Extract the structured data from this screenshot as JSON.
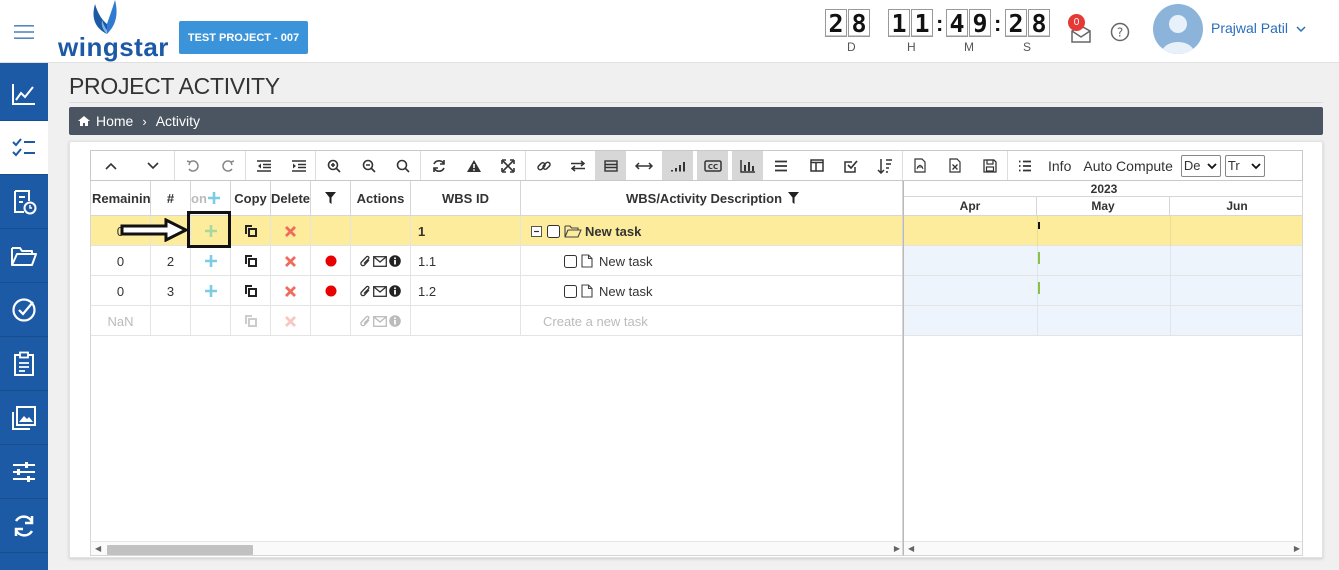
{
  "app": {
    "logo_text": "wingstar"
  },
  "header": {
    "project_button": "TEST PROJECT - 007",
    "timer": {
      "days": "28",
      "hours": "11",
      "minutes": "49",
      "seconds": "28",
      "labels": {
        "d": "D",
        "h": "H",
        "m": "M",
        "s": "S"
      }
    },
    "notification_count": "0",
    "user_name": "Prajwal Patil"
  },
  "sidebar": {
    "items": [
      {
        "icon": "chart-line-icon",
        "active": false
      },
      {
        "icon": "tasklist-icon",
        "active": true
      },
      {
        "icon": "document-clock-icon",
        "active": false
      },
      {
        "icon": "folder-open-icon",
        "active": false
      },
      {
        "icon": "check-circle-icon",
        "active": false
      },
      {
        "icon": "clipboard-icon",
        "active": false
      },
      {
        "icon": "gallery-icon",
        "active": false
      },
      {
        "icon": "sliders-icon",
        "active": false
      },
      {
        "icon": "sync-icon",
        "active": false
      }
    ]
  },
  "page": {
    "title": "PROJECT ACTIVITY",
    "breadcrumb": {
      "home": "Home",
      "current": "Activity"
    }
  },
  "toolbar": {
    "info_label": "Info",
    "auto_compute_label": "Auto Compute",
    "select1_value": "De",
    "select2_value": "Tr",
    "icons": [
      "chevron-up-icon",
      "chevron-down-icon",
      "undo-icon",
      "redo-icon",
      "outdent-icon",
      "indent-icon",
      "zoom-in-icon",
      "zoom-out-icon",
      "search-icon",
      "refresh-icon",
      "warning-icon",
      "expand-icon",
      "link-icon",
      "swap-icon",
      "rows-icon",
      "width-icon",
      "signal-icon",
      "cc-icon",
      "bar-chart-icon",
      "menu-icon",
      "columns-icon",
      "checklist-icon",
      "sort-icon",
      "pdf-icon",
      "excel-icon",
      "save-icon",
      "list-icon"
    ]
  },
  "grid": {
    "columns": {
      "remaining": "Remaining",
      "num": "#",
      "add": "on",
      "copy": "Copy",
      "delete": "Delete",
      "actions": "Actions",
      "wbs_id": "WBS ID",
      "description": "WBS/Activity Description"
    },
    "rows": [
      {
        "remaining": "0",
        "num": "",
        "wbs_id": "1",
        "description": "New task",
        "selected": true,
        "parent": true,
        "dot": false
      },
      {
        "remaining": "0",
        "num": "2",
        "wbs_id": "1.1",
        "description": "New task",
        "selected": false,
        "parent": false,
        "dot": true
      },
      {
        "remaining": "0",
        "num": "3",
        "wbs_id": "1.2",
        "description": "New task",
        "selected": false,
        "parent": false,
        "dot": true
      }
    ],
    "new_row": {
      "remaining": "NaN",
      "description": "Create a new task"
    }
  },
  "gantt": {
    "year": "2023",
    "months": [
      "Apr",
      "May",
      "Jun"
    ]
  },
  "colors": {
    "brand": "#1c5aa6",
    "button": "#3b94d9",
    "selected_row": "#fcec9c",
    "breadcrumb": "#4a5561",
    "delete": "#f06a5e",
    "add": "#7ecbe6",
    "dot": "#e80000"
  }
}
